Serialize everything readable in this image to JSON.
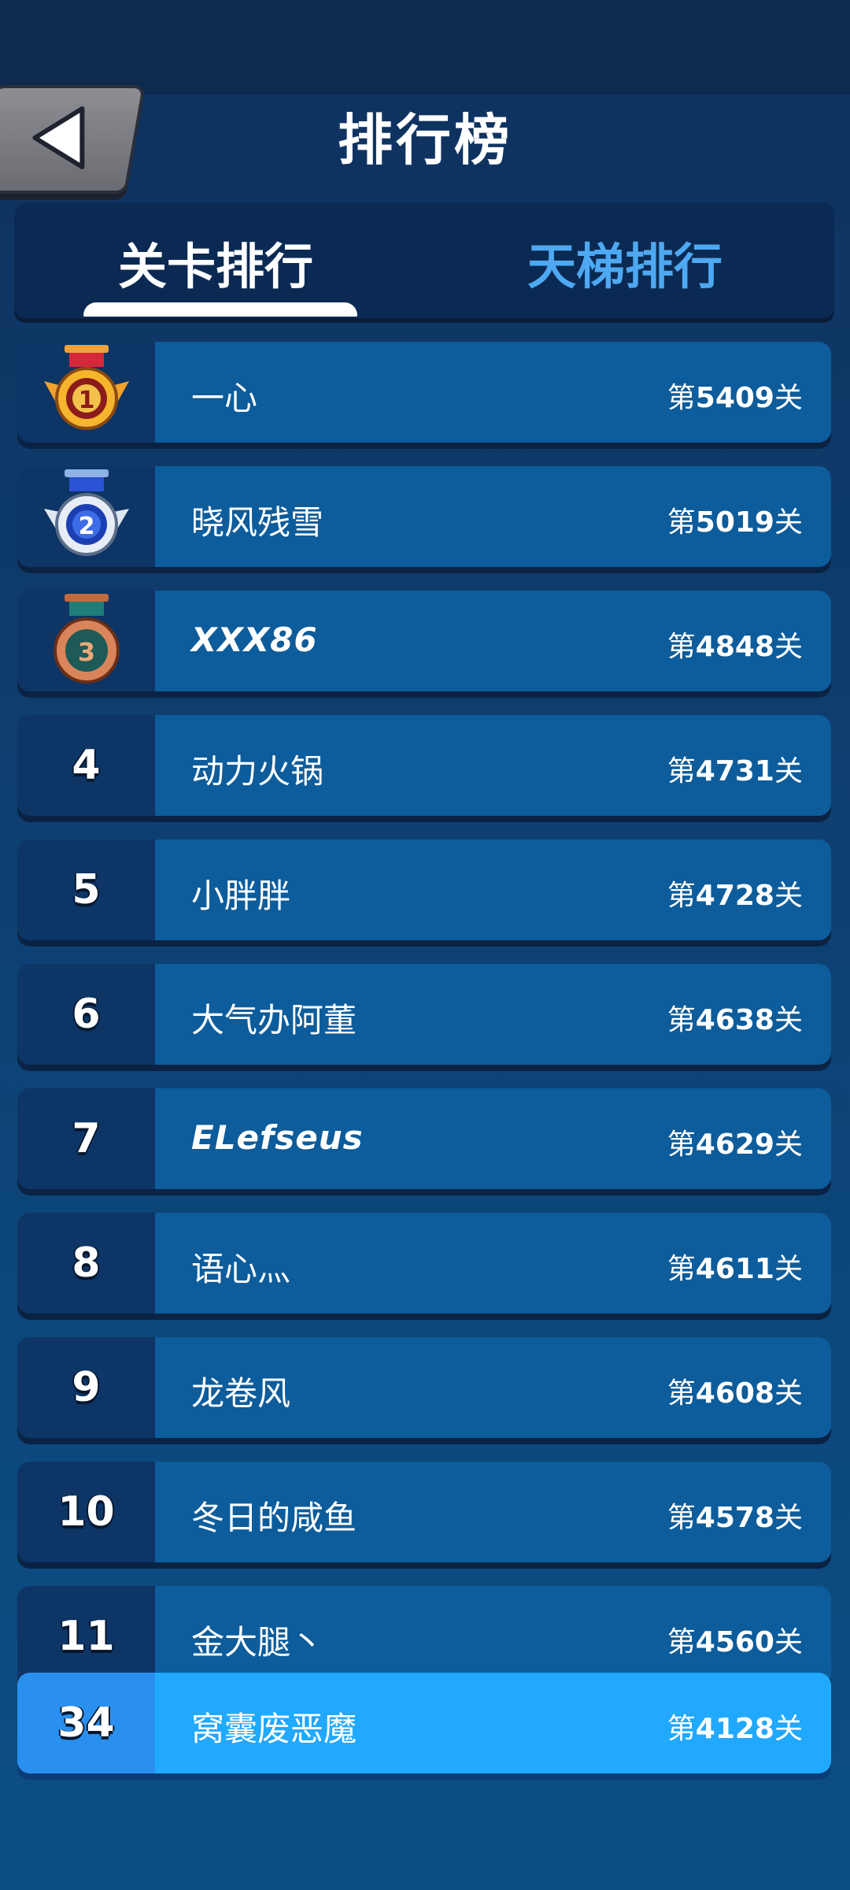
{
  "header": {
    "title": "排行榜"
  },
  "tabs": [
    {
      "label": "关卡排行",
      "active": true
    },
    {
      "label": "天梯排行",
      "active": false
    }
  ],
  "colors": {
    "row_bg": "#0d5c9b",
    "rank_cell_bg": "#0d3565",
    "my_row_bg": "#21a8ff",
    "inactive_tab": "#4ea8f2"
  },
  "leaderboard": [
    {
      "rank": "1",
      "medal": "gold-medal-icon",
      "name": "一心",
      "level_prefix": "第",
      "level": "5409",
      "level_suffix": "关"
    },
    {
      "rank": "2",
      "medal": "silver-medal-icon",
      "name": "晓风残雪",
      "level_prefix": "第",
      "level": "5019",
      "level_suffix": "关"
    },
    {
      "rank": "3",
      "medal": "bronze-medal-icon",
      "name": "XXX86",
      "level_prefix": "第",
      "level": "4848",
      "level_suffix": "关"
    },
    {
      "rank": "4",
      "name": "动力火锅",
      "level_prefix": "第",
      "level": "4731",
      "level_suffix": "关"
    },
    {
      "rank": "5",
      "name": "小胖胖",
      "level_prefix": "第",
      "level": "4728",
      "level_suffix": "关"
    },
    {
      "rank": "6",
      "name": "大气办阿董",
      "level_prefix": "第",
      "level": "4638",
      "level_suffix": "关"
    },
    {
      "rank": "7",
      "name": "ELefseus",
      "level_prefix": "第",
      "level": "4629",
      "level_suffix": "关"
    },
    {
      "rank": "8",
      "name": "语心灬",
      "level_prefix": "第",
      "level": "4611",
      "level_suffix": "关"
    },
    {
      "rank": "9",
      "name": "龙卷风",
      "level_prefix": "第",
      "level": "4608",
      "level_suffix": "关"
    },
    {
      "rank": "10",
      "name": "冬日的咸鱼",
      "level_prefix": "第",
      "level": "4578",
      "level_suffix": "关"
    },
    {
      "rank": "11",
      "name": "金大腿丶",
      "level_prefix": "第",
      "level": "4560",
      "level_suffix": "关"
    }
  ],
  "my_rank": {
    "rank": "34",
    "name": "窝囊废恶魔",
    "level_prefix": "第",
    "level": "4128",
    "level_suffix": "关"
  }
}
